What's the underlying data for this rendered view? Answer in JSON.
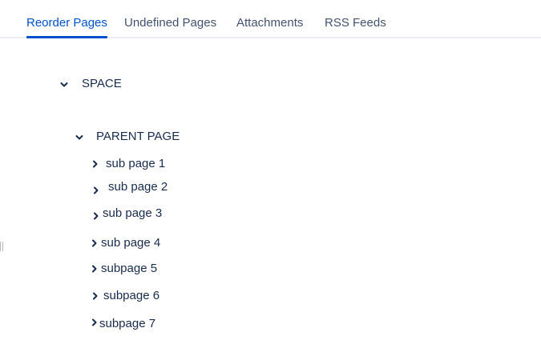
{
  "tabs": [
    {
      "label": "Reorder Pages",
      "active": true
    },
    {
      "label": "Undefined Pages",
      "active": false
    },
    {
      "label": "Attachments",
      "active": false
    },
    {
      "label": "RSS Feeds",
      "active": false
    }
  ],
  "colors": {
    "active_tab": "#0052cc",
    "tab_text": "#42526e",
    "tree_text": "#172b4d",
    "divider": "#ebecf0"
  },
  "tree": {
    "space": {
      "label": "SPACE",
      "icon": "chevron-down-icon",
      "expanded": true
    },
    "parent": {
      "label": "PARENT PAGE",
      "icon": "chevron-down-icon",
      "expanded": true
    },
    "children": [
      {
        "label": "sub page 1",
        "icon": "chevron-right-icon"
      },
      {
        "label": "sub page 2",
        "icon": "chevron-right-icon"
      },
      {
        "label": "sub page 3",
        "icon": "chevron-right-icon"
      },
      {
        "label": "sub page 4",
        "icon": "chevron-right-icon"
      },
      {
        "label": "subpage 5",
        "icon": "chevron-right-icon"
      },
      {
        "label": "subpage 6",
        "icon": "chevron-right-icon"
      },
      {
        "label": "subpage 7",
        "icon": "chevron-right-icon"
      }
    ]
  }
}
